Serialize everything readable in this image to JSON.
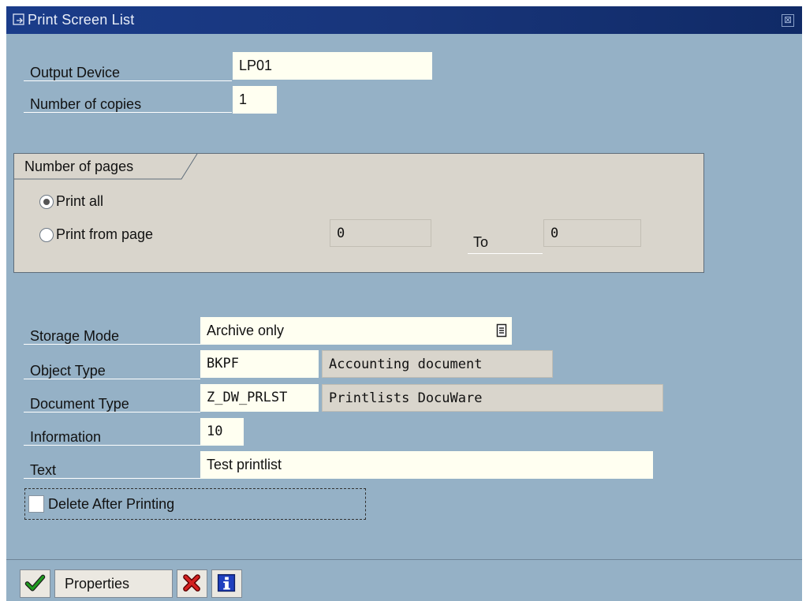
{
  "window": {
    "title": "Print Screen List",
    "close_symbol": "⊠"
  },
  "print": {
    "output_device_label": "Output Device",
    "output_device_value": "LP01",
    "copies_label": "Number of copies",
    "copies_value": "1"
  },
  "pages": {
    "group_title": "Number of pages",
    "print_all_label": "Print all",
    "print_all_selected": true,
    "print_from_label": "Print from page",
    "from_value": "0",
    "to_label": "To",
    "to_value": "0"
  },
  "archive": {
    "storage_mode_label": "Storage Mode",
    "storage_mode_value": "Archive only",
    "object_type_label": "Object Type",
    "object_type_value": "BKPF",
    "object_type_desc": "Accounting document",
    "document_type_label": "Document Type",
    "document_type_value": "Z_DW_PRLST",
    "document_type_desc": "Printlists DocuWare",
    "information_label": "Information",
    "information_value": "10",
    "text_label": "Text",
    "text_value": "Test printlist"
  },
  "options": {
    "delete_after_printing_label": "Delete After Printing",
    "delete_after_printing_checked": false
  },
  "toolbar": {
    "properties_label": "Properties"
  },
  "icons": {
    "title": "print-window-icon",
    "dropdown": "list-dropdown-icon",
    "confirm": "checkmark-icon",
    "cancel": "cancel-x-icon",
    "info": "info-icon"
  },
  "colors": {
    "titlebar": "#18357a",
    "background": "#95b1c6",
    "input": "#fffff1",
    "readonly": "#d9d5cc",
    "confirm_green": "#1f9a1f",
    "cancel_red": "#d42020",
    "info_blue": "#1f3fbf"
  }
}
